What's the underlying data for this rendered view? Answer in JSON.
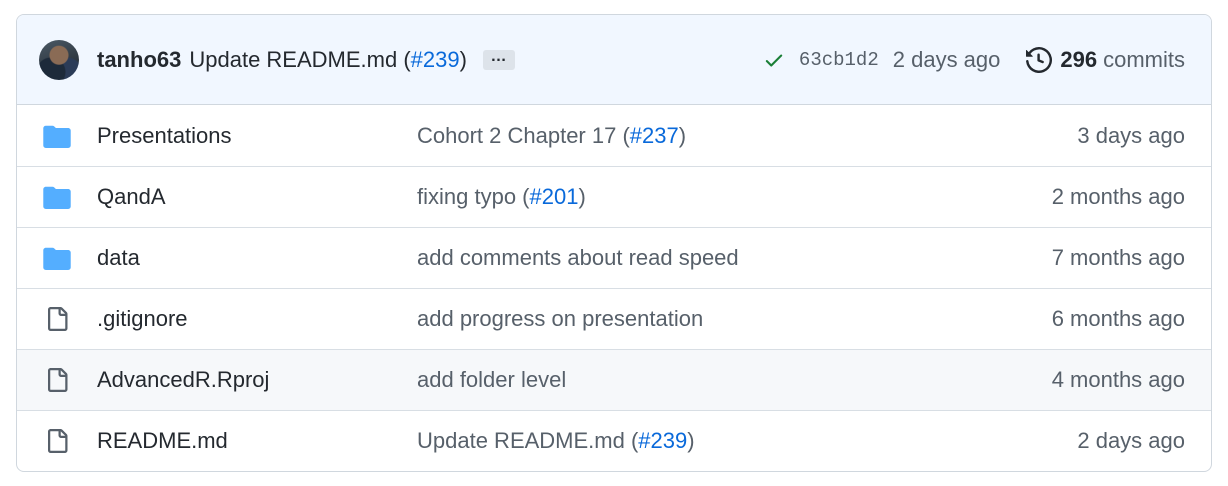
{
  "latest_commit": {
    "author": "tanho63",
    "message": "Update README.md (",
    "pr": "#239",
    "message_suffix": ")",
    "ellipsis": "…",
    "sha": "63cb1d2",
    "date": "2 days ago",
    "commit_count": "296",
    "commits_label": "commits"
  },
  "files": [
    {
      "type": "folder",
      "name": "Presentations",
      "msg": "Cohort 2 Chapter 17 (",
      "pr": "#237",
      "suffix": ")",
      "age": "3 days ago"
    },
    {
      "type": "folder",
      "name": "QandA",
      "msg": "fixing typo (",
      "pr": "#201",
      "suffix": ")",
      "age": "2 months ago"
    },
    {
      "type": "folder",
      "name": "data",
      "msg": "add comments about read speed",
      "pr": "",
      "suffix": "",
      "age": "7 months ago"
    },
    {
      "type": "file",
      "name": ".gitignore",
      "msg": "add progress on presentation",
      "pr": "",
      "suffix": "",
      "age": "6 months ago"
    },
    {
      "type": "file",
      "name": "AdvancedR.Rproj",
      "msg": "add folder level",
      "pr": "",
      "suffix": "",
      "age": "4 months ago"
    },
    {
      "type": "file",
      "name": "README.md",
      "msg": "Update README.md (",
      "pr": "#239",
      "suffix": ")",
      "age": "2 days ago"
    }
  ],
  "colors": {
    "folder": "#54aeff",
    "file": "#57606a",
    "check": "#1a7f37",
    "link": "#0969da"
  },
  "icons": {
    "folder": "folder-icon",
    "file": "file-icon",
    "check": "check-icon",
    "history": "history-icon"
  }
}
